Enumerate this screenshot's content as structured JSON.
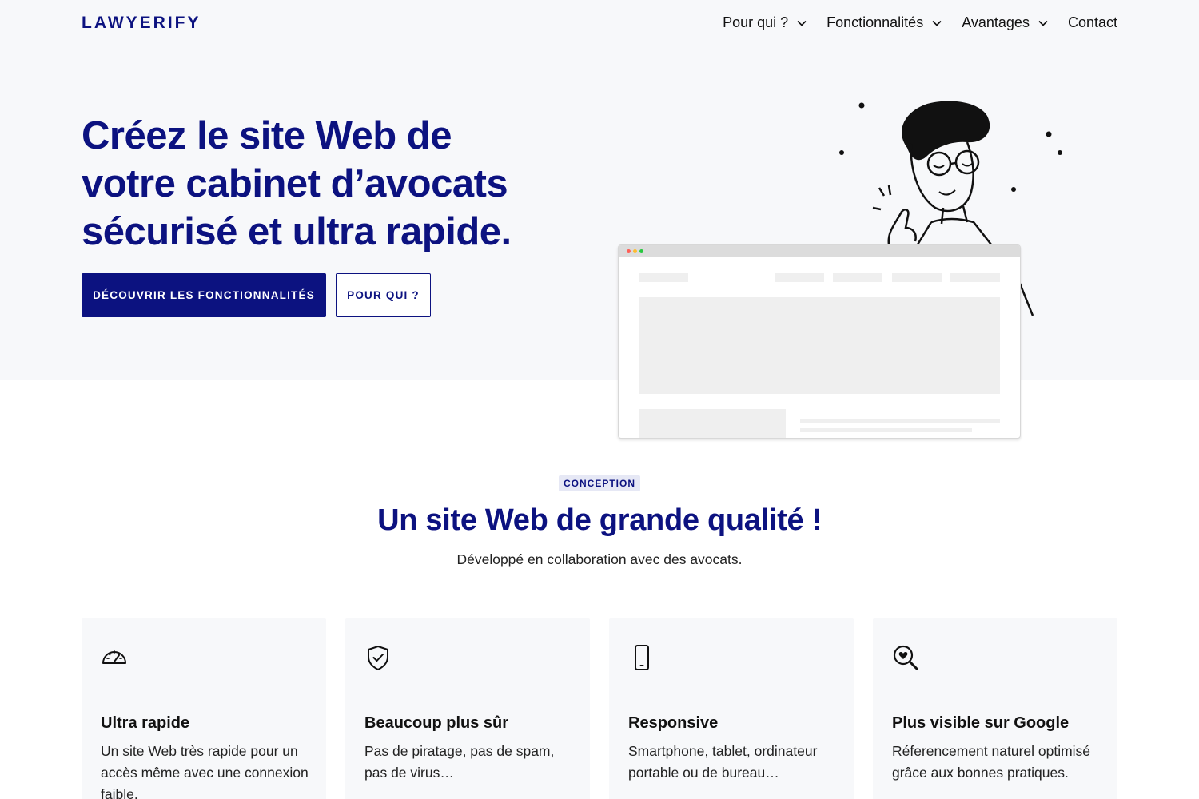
{
  "header": {
    "logo": "LAWYERIFY",
    "nav": [
      {
        "label": "Pour qui ?",
        "icon": "chevron-down-icon"
      },
      {
        "label": "Fonctionnalités",
        "icon": "chevron-down-icon"
      },
      {
        "label": "Avantages",
        "icon": "chevron-down-icon"
      },
      {
        "label": "Contact"
      }
    ]
  },
  "hero": {
    "title_lines": [
      "Créez le site Web de",
      "votre cabinet d’avocats",
      "sécurisé et ultra rapide."
    ],
    "primary_button": "DÉCOUVRIR LES FONCTIONNALITÉS",
    "secondary_button": "POUR QUI ?"
  },
  "section": {
    "tag": "CONCEPTION",
    "title": "Un site Web de grande qualité !",
    "subtitle": "Développé en collaboration avec des avocats."
  },
  "features": [
    {
      "icon": "speedometer-icon",
      "title": "Ultra rapide",
      "text": "Un site Web très rapide pour un accès même avec une connexion faible."
    },
    {
      "icon": "shield-check-icon",
      "title": "Beaucoup plus sûr",
      "text": "Pas de piratage, pas de spam, pas de virus…"
    },
    {
      "icon": "smartphone-icon",
      "title": "Responsive",
      "text": "Smartphone, tablet, ordinateur portable ou de bureau…"
    },
    {
      "icon": "search-heart-icon",
      "title": "Plus visible sur Google",
      "text": "Réferencement naturel optimisé grâce aux bonnes pratiques."
    }
  ],
  "colors": {
    "brand": "#0c1280",
    "hero_bg": "#f7f8fa",
    "card_bg": "#f7f8fa",
    "tag_bg": "#e6e8f5"
  }
}
